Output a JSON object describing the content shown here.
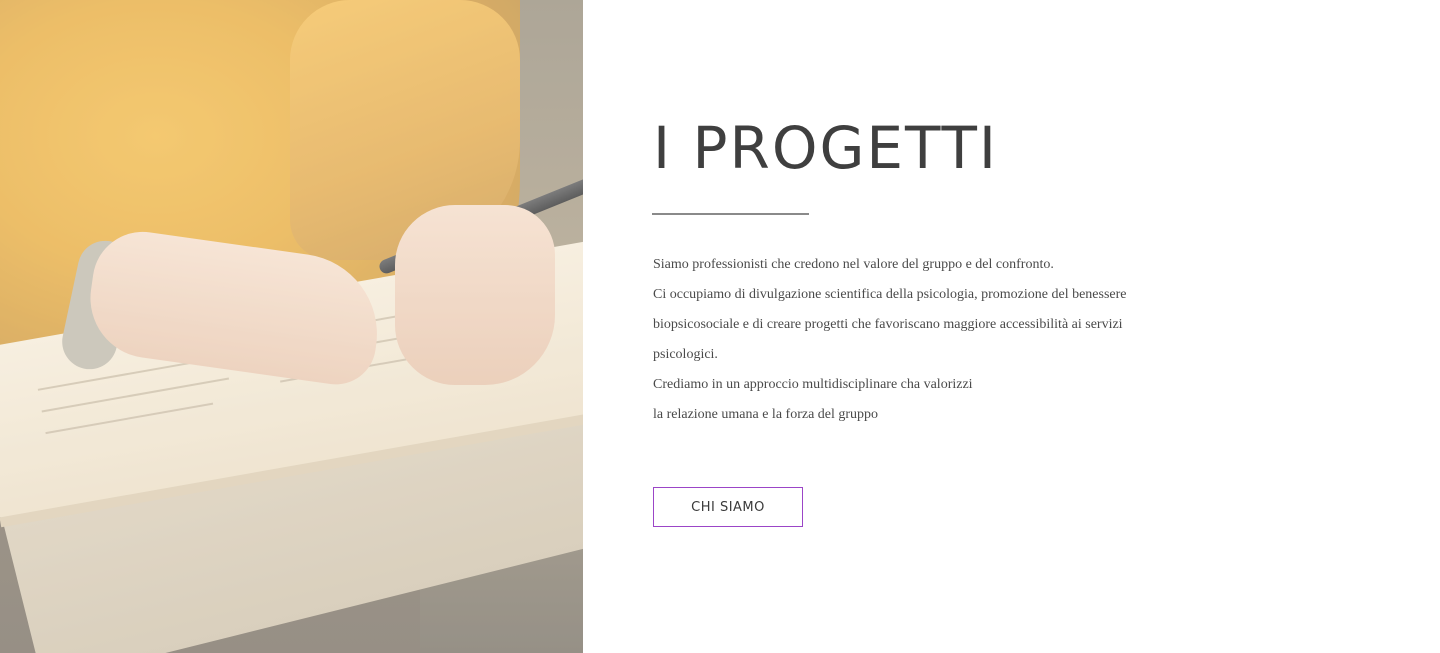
{
  "section": {
    "title": "I PROGETTI",
    "paragraph_lines": [
      "Siamo professionisti che credono nel valore del gruppo e del confronto.",
      "Ci occupiamo di divulgazione scientifica della psicologia, promozione del benessere",
      "biopsicosociale e di creare progetti che favoriscano maggiore accessibilità ai servizi",
      "psicologici.",
      "Crediamo in un approccio multidisciplinare cha valorizzi",
      "la relazione umana e la forza del gruppo"
    ],
    "button_label": "CHI SIAMO"
  },
  "colors": {
    "title": "#3f3f3f",
    "text": "#4a4a4a",
    "button_border": "#9b45c7",
    "divider": "#8a8a8a"
  }
}
